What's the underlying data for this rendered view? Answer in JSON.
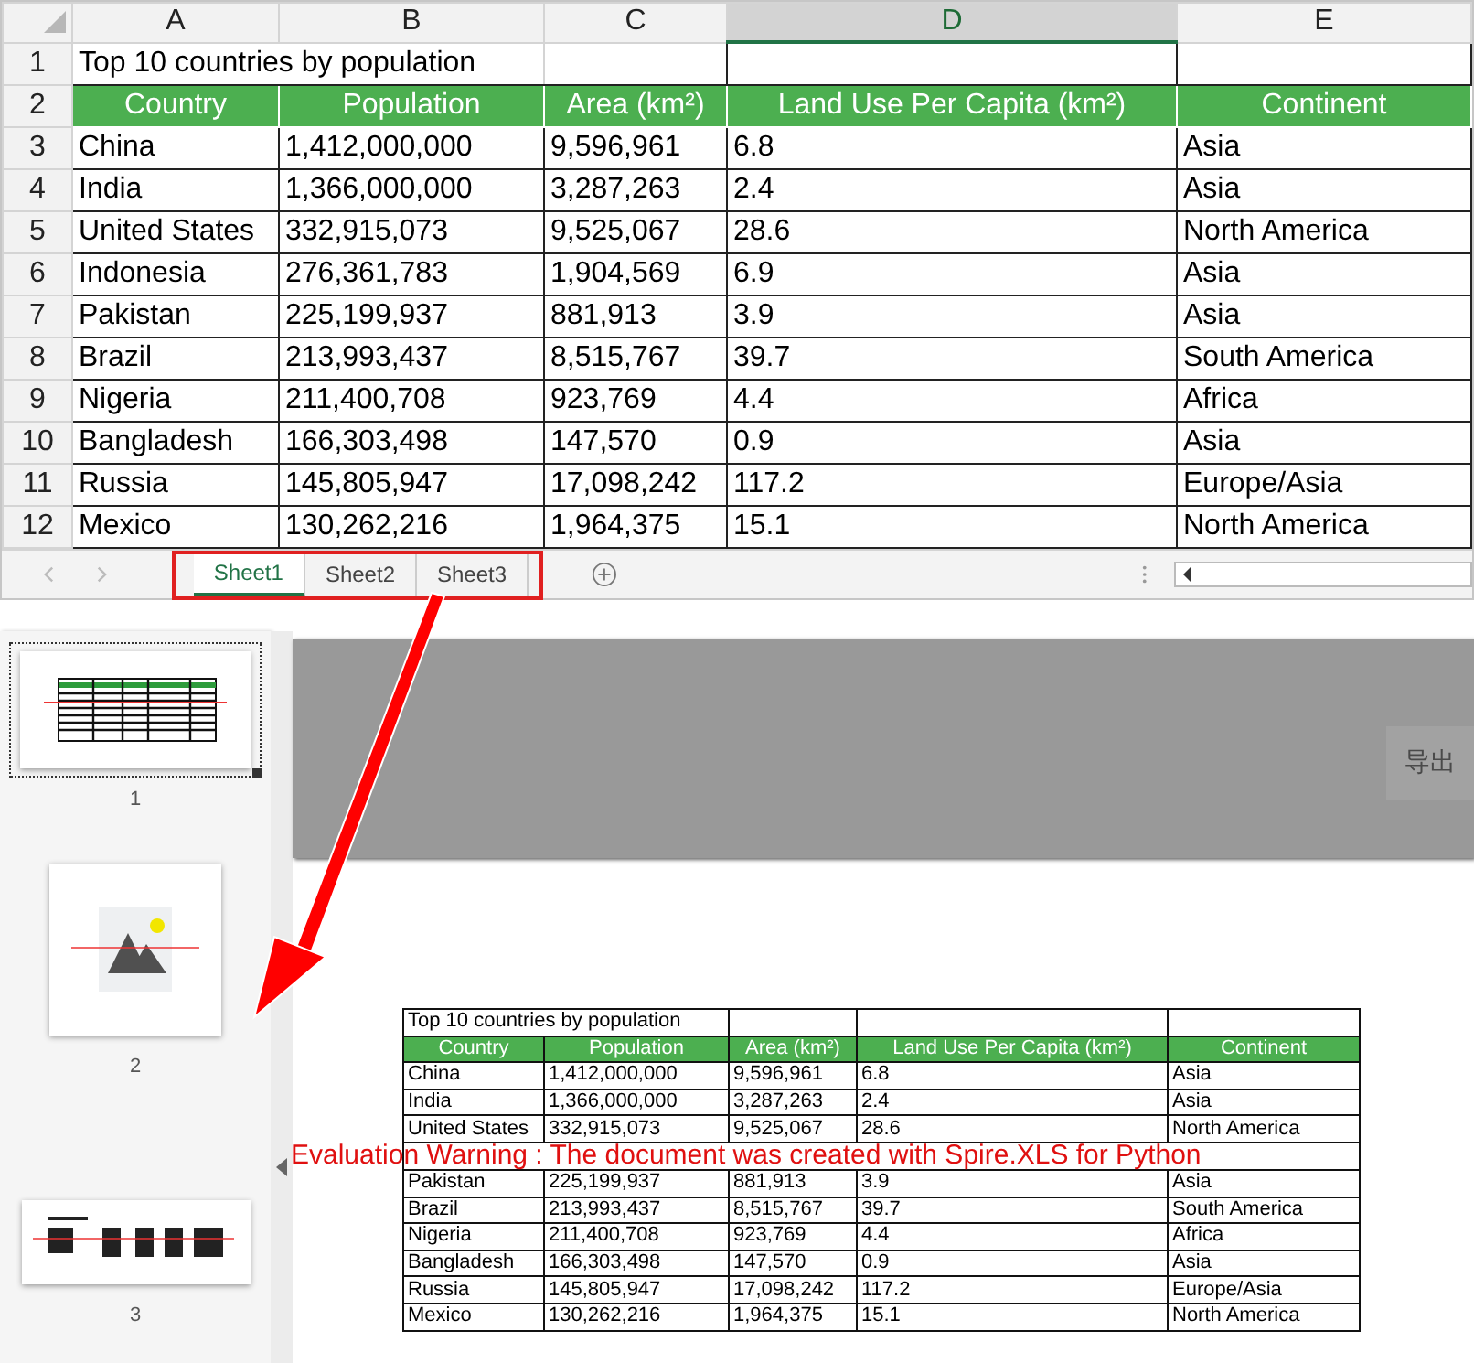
{
  "spreadsheet": {
    "columns": [
      {
        "label": "A",
        "selected": false
      },
      {
        "label": "B",
        "selected": false
      },
      {
        "label": "C",
        "selected": false
      },
      {
        "label": "D",
        "selected": true
      },
      {
        "label": "E",
        "selected": false
      }
    ],
    "row_numbers": [
      "1",
      "2",
      "3",
      "4",
      "5",
      "6",
      "7",
      "8",
      "9",
      "10",
      "11",
      "12"
    ],
    "title": "Top 10 countries by population",
    "headers": [
      "Country",
      "Population",
      "Area (km²)",
      "Land Use Per Capita (km²)",
      "Continent"
    ],
    "rows": [
      [
        "China",
        "1,412,000,000",
        "9,596,961",
        "6.8",
        "Asia"
      ],
      [
        "India",
        "1,366,000,000",
        "3,287,263",
        "2.4",
        "Asia"
      ],
      [
        "United States",
        "332,915,073",
        "9,525,067",
        "28.6",
        "North America"
      ],
      [
        "Indonesia",
        "276,361,783",
        "1,904,569",
        "6.9",
        "Asia"
      ],
      [
        "Pakistan",
        "225,199,937",
        "881,913",
        "3.9",
        "Asia"
      ],
      [
        "Brazil",
        "213,993,437",
        "8,515,767",
        "39.7",
        "South America"
      ],
      [
        "Nigeria",
        "211,400,708",
        "923,769",
        "4.4",
        "Africa"
      ],
      [
        "Bangladesh",
        "166,303,498",
        "147,570",
        "0.9",
        "Asia"
      ],
      [
        "Russia",
        "145,805,947",
        "17,098,242",
        "117.2",
        "Europe/Asia"
      ],
      [
        "Mexico",
        "130,262,216",
        "1,964,375",
        "15.1",
        "North America"
      ]
    ],
    "sheet_tabs": [
      {
        "label": "Sheet1",
        "selected": true
      },
      {
        "label": "Sheet2",
        "selected": false
      },
      {
        "label": "Sheet3",
        "selected": false
      }
    ]
  },
  "preview": {
    "thumbnails": [
      {
        "number": "1",
        "selected": true,
        "kind": "table"
      },
      {
        "number": "2",
        "selected": false,
        "kind": "image"
      },
      {
        "number": "3",
        "selected": false,
        "kind": "text"
      }
    ],
    "export_button": "导出",
    "document": {
      "title": "Top 10 countries by population",
      "headers": [
        "Country",
        "Population",
        "Area (km²)",
        "Land Use Per Capita (km²)",
        "Continent"
      ],
      "rows": [
        {
          "kind": "data",
          "cells": [
            "China",
            "1,412,000,000",
            "9,596,961",
            "6.8",
            "Asia"
          ]
        },
        {
          "kind": "data",
          "cells": [
            "India",
            "1,366,000,000",
            "3,287,263",
            "2.4",
            "Asia"
          ]
        },
        {
          "kind": "data",
          "cells": [
            "United States",
            "332,915,073",
            "9,525,067",
            "28.6",
            "North America"
          ]
        },
        {
          "kind": "warning",
          "text": "Evaluation Warning : The document was created with  Spire.XLS for Python"
        },
        {
          "kind": "data",
          "cells": [
            "Pakistan",
            "225,199,937",
            "881,913",
            "3.9",
            "Asia"
          ]
        },
        {
          "kind": "data",
          "cells": [
            "Brazil",
            "213,993,437",
            "8,515,767",
            "39.7",
            "South America"
          ]
        },
        {
          "kind": "data",
          "cells": [
            "Nigeria",
            "211,400,708",
            "923,769",
            "4.4",
            "Africa"
          ]
        },
        {
          "kind": "data",
          "cells": [
            "Bangladesh",
            "166,303,498",
            "147,570",
            "0.9",
            "Asia"
          ]
        },
        {
          "kind": "data",
          "cells": [
            "Russia",
            "145,805,947",
            "17,098,242",
            "117.2",
            "Europe/Asia"
          ]
        },
        {
          "kind": "data",
          "cells": [
            "Mexico",
            "130,262,216",
            "1,964,375",
            "15.1",
            "North America"
          ]
        }
      ]
    }
  }
}
